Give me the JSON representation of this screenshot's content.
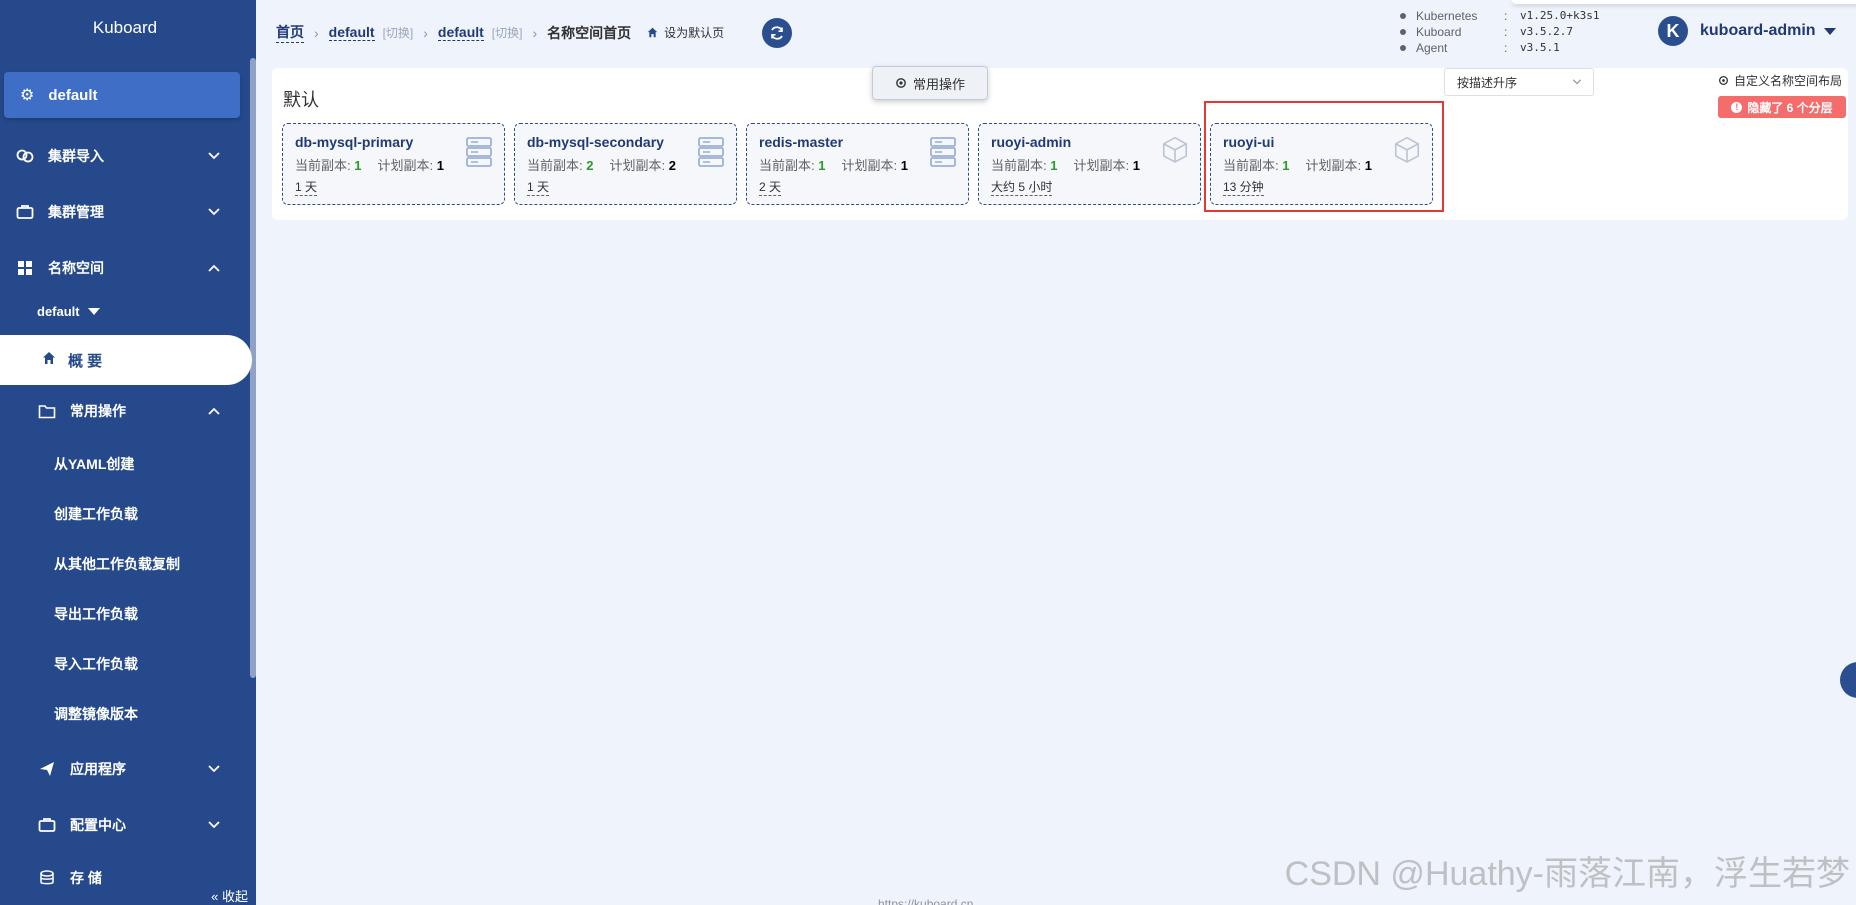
{
  "sidebar": {
    "brand": "Kuboard",
    "namespace": "default",
    "menu": {
      "cluster_import": "集群导入",
      "cluster_manage": "集群管理",
      "namespace": "名称空间",
      "ns_dropdown": "default",
      "overview": "概 要",
      "common_ops": "常用操作",
      "apps": "应用程序",
      "config": "配置中心",
      "storage": "存 储"
    },
    "sub_items": [
      "从YAML创建",
      "创建工作负载",
      "从其他工作负载复制",
      "导出工作负载",
      "导入工作负载",
      "调整镜像版本"
    ],
    "collapse": "« 收起"
  },
  "header": {
    "crumb_home": "首页",
    "crumb_cluster": "default",
    "crumb_ns": "default",
    "switch_label": "[切换]",
    "crumb_current": "名称空间首页",
    "set_default": "设为默认页",
    "versions": [
      {
        "name": "Kubernetes",
        "value": "v1.25.0+k3s1"
      },
      {
        "name": "Kuboard",
        "value": "v3.5.2.7"
      },
      {
        "name": "Agent",
        "value": "v3.5.1"
      }
    ],
    "user_initial": "K",
    "user_name": "kuboard-admin"
  },
  "main": {
    "layer_title": "默认",
    "ops_button": "常用操作",
    "sort_value": "按描述升序",
    "custom_layout": "自定义名称空间布局",
    "hidden_badge": "隐藏了 6 个分层",
    "replica_current_label": "当前副本:",
    "replica_plan_label": "计划副本:",
    "workloads": [
      {
        "name": "db-mysql-primary",
        "current": "1",
        "planned": "1",
        "age": "1 天",
        "icon": "server-icon"
      },
      {
        "name": "db-mysql-secondary",
        "current": "2",
        "planned": "2",
        "age": "1 天",
        "icon": "server-icon"
      },
      {
        "name": "redis-master",
        "current": "1",
        "planned": "1",
        "age": "2 天",
        "icon": "server-icon"
      },
      {
        "name": "ruoyi-admin",
        "current": "1",
        "planned": "1",
        "age": "大约 5 小时",
        "icon": "cube-icon"
      },
      {
        "name": "ruoyi-ui",
        "current": "1",
        "planned": "1",
        "age": "13 分钟",
        "icon": "cube-icon"
      }
    ]
  },
  "footer_url": "https://kuboard.cn",
  "watermark": "CSDN @Huathy-雨落江南，浮生若梦",
  "colors": {
    "sidebar": "#26498b",
    "accent": "#2b4f8e",
    "highlight": "#e53935",
    "badge": "#f56c6c"
  }
}
